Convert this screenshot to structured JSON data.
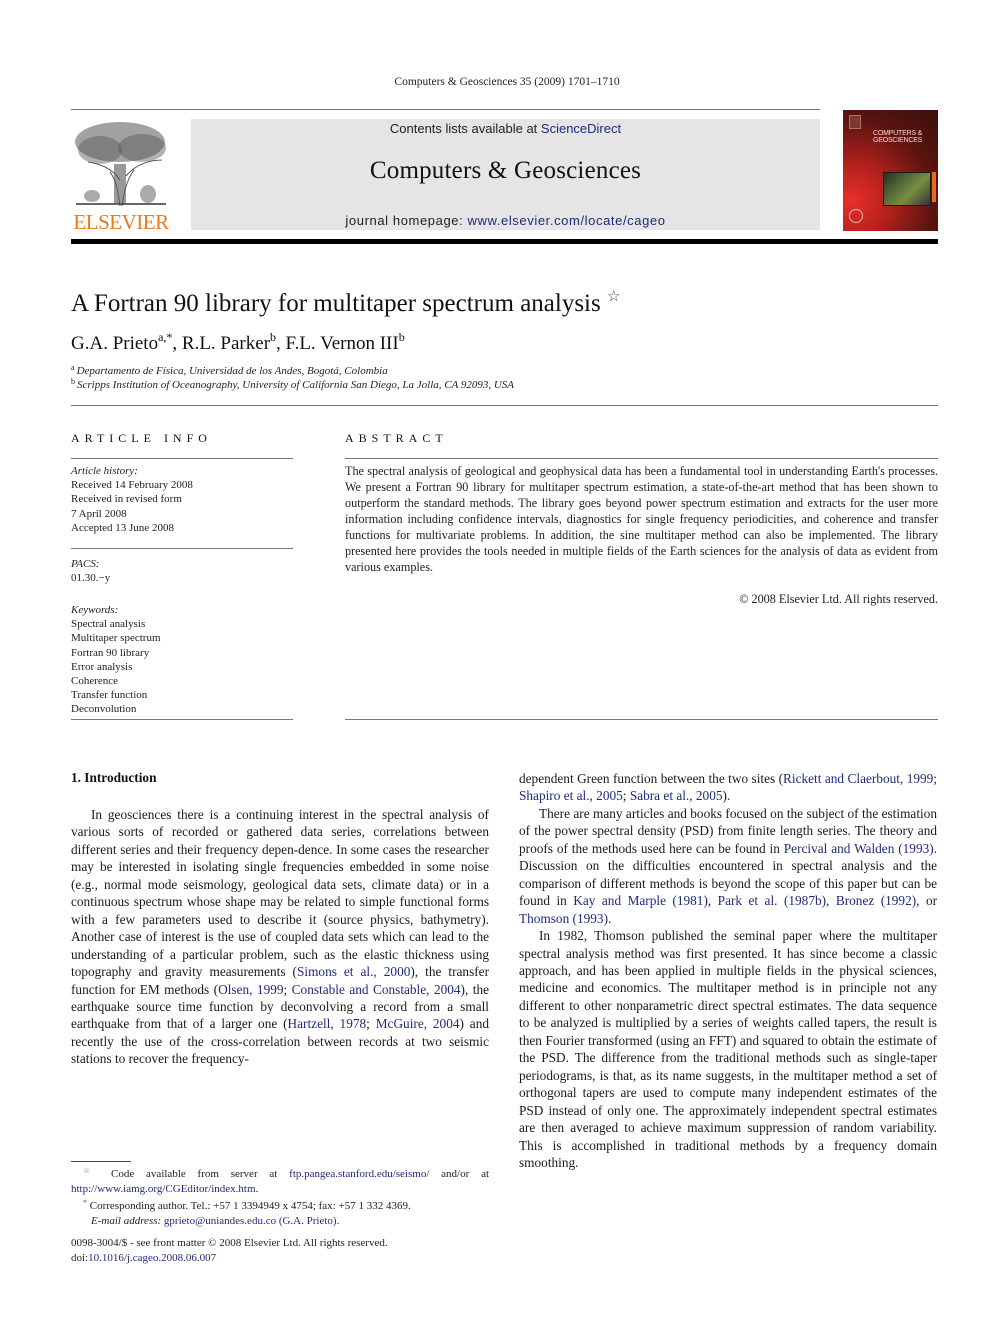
{
  "running_head": "Computers & Geosciences 35 (2009) 1701–1710",
  "masthead": {
    "publisher_logo": "ELSEVIER",
    "contents_prefix": "Contents lists available at ",
    "contents_link": "ScienceDirect",
    "journal_name": "Computers & Geosciences",
    "homepage_prefix": "journal homepage: ",
    "homepage_link": "www.elsevier.com/locate/cageo",
    "cover_title_line1": "COMPUTERS &",
    "cover_title_line2": "GEOSCIENCES"
  },
  "article": {
    "title": "A Fortran 90 library for multitaper spectrum analysis",
    "title_mark": "☆",
    "authors": [
      {
        "name": "G.A. Prieto",
        "sup": "a,*"
      },
      {
        "name": "R.L. Parker",
        "sup": "b"
      },
      {
        "name": "F.L. Vernon III",
        "sup": "b"
      }
    ],
    "affiliations": [
      {
        "sup": "a",
        "text": "Departamento de Física, Universidad de los Andes, Bogotá, Colombia"
      },
      {
        "sup": "b",
        "text": "Scripps Institution of Oceanography, University of California San Diego, La Jolla, CA 92093, USA"
      }
    ]
  },
  "article_info": {
    "heading": "ARTICLE INFO",
    "history_label": "Article history:",
    "history": [
      "Received 14 February 2008",
      "Received in revised form",
      "7 April 2008",
      "Accepted 13 June 2008"
    ],
    "pacs_label": "PACS:",
    "pacs": "01.30.−y",
    "keywords_label": "Keywords:",
    "keywords": [
      "Spectral analysis",
      "Multitaper spectrum",
      "Fortran 90 library",
      "Error analysis",
      "Coherence",
      "Transfer function",
      "Deconvolution"
    ]
  },
  "abstract": {
    "heading": "ABSTRACT",
    "text": "The spectral analysis of geological and geophysical data has been a fundamental tool in understanding Earth's processes. We present a Fortran 90 library for multitaper spectrum estimation, a state-of-the-art method that has been shown to outperform the standard methods. The library goes beyond power spectrum estimation and extracts for the user more information including confidence intervals, diagnostics for single frequency periodicities, and coherence and transfer functions for multivariate problems. In addition, the sine multitaper method can also be implemented. The library presented here provides the tools needed in multiple fields of the Earth sciences for the analysis of data as evident from various examples.",
    "copyright": "© 2008 Elsevier Ltd. All rights reserved."
  },
  "body": {
    "section_heading": "1.  Introduction",
    "p1": {
      "t1": "In geosciences there is a continuing interest in the spectral analysis of various sorts of recorded or gathered data series, correlations between different series and their frequency depen­dence. In some cases the researcher may be interested in isolating single frequencies embedded in some noise (e.g., normal mode seismology, geological data sets, climate data) or in a continuous spectrum whose shape may be related to simple functional forms with a few parameters used to describe it (source physics, bathymetry). Another case of interest is the use of coupled data sets which can lead to the understanding of a particular problem, such as the elastic thickness using topography and gravity measurements (",
      "c1": "Simons et al., 2000",
      "t2": "), the transfer function for EM methods (",
      "c2": "Olsen, 1999",
      "t3": "; ",
      "c3": "Constable and Constable, 2004",
      "t4": "), the earthquake source time function by deconvolving a record from a small earthquake from that of a larger one (",
      "c4": "Hartzell, 1978",
      "t5": "; ",
      "c5": "McGuire, 2004",
      "t6": ") and recently the use of the cross-correlation between records at two seismic stations to recover the frequency-dependent Green function between the two sites (",
      "c6": "Rickett and Claerbout, 1999",
      "t7": "; ",
      "c7": "Shapiro et al., 2005",
      "t8": "; ",
      "c8": "Sabra et al., 2005",
      "t9": ")."
    },
    "p1_left_part": "In geosciences there is a continuing interest in the spectral analysis of various sorts of recorded or gathered data series, correlations between different series and their frequency depen-dence. In some cases the researcher may be interested in isolating single frequencies embedded in some noise (e.g., normal mode seismology, geological data sets, climate data) or in a continuous spectrum whose shape may be related to simple functional forms with a few parameters used to describe it (source physics, bathymetry). Another case of interest is the use of coupled data sets which can lead to the understanding of a particular problem, such as the elastic thickness using topography and gravity measurements (",
    "p1_right_start": "dependent Green function between the two sites (",
    "left_end": ") and recently the use of the cross-correlation between records at two seismic stations to recover the frequency-",
    "p2": {
      "t1": "There are many articles and books focused on the subject of the estimation of the power spectral density (PSD) from finite length series. The theory and proofs of the methods used here can be found in ",
      "c1": "Percival and Walden (1993)",
      "t2": ". Discussion on the difficulties encountered in spectral analysis and the comparison of different methods is beyond the scope of this paper but can be found in ",
      "c2": "Kay and Marple (1981)",
      "t3": ", ",
      "c3": "Park et al. (1987b)",
      "t4": ", ",
      "c4": "Bronez (1992)",
      "t5": ", or ",
      "c5": "Thomson (1993)",
      "t6": "."
    },
    "p3": "In 1982, Thomson published the seminal paper where the multitaper spectral analysis method was first presented. It has since become a classic approach, and has been applied in multiple fields in the physical sciences, medicine and economics. The multitaper method is in principle not any different to other nonparametric direct spectral estimates. The data sequence to be analyzed is multiplied by a series of weights called tapers, the result is then Fourier transformed (using an FFT) and squared to obtain the estimate of the PSD. The difference from the traditional methods such as single-taper periodograms, is that, as its name suggests, in the multitaper method a set of orthogonal tapers are used to compute many independent estimates of the PSD instead of only one. The approximately independent spectral estimates are then averaged to achieve maximum suppression of random variability. This is accomplished in traditional methods by a frequency domain smoothing."
  },
  "footnotes": {
    "star_mark": "☆",
    "star_text": " Code available from server at ",
    "star_link1": "ftp.pangea.stanford.edu/seismo/",
    "star_mid": " and/or at ",
    "star_link2": "http://www.iamg.org/CGEditor/index.htm",
    "star_end": ".",
    "corr_mark": "*",
    "corr_text": " Corresponding author. Tel.: +57 1 3394949 x 4754; fax: +57 1 332 4369.",
    "email_label": "E-mail address:",
    "email_link": "gprieto@uniandes.edu.co (G.A. Prieto)",
    "email_end": "."
  },
  "front_matter": {
    "issn_line": "0098-3004/$ - see front matter © 2008 Elsevier Ltd. All rights reserved.",
    "doi_prefix": "doi:",
    "doi_link": "10.1016/j.cageo.2008.06.007"
  },
  "colors": {
    "link": "#1f2a7a",
    "elsevier_orange": "#e87a1e",
    "masthead_gray": "#e5e5e5"
  }
}
